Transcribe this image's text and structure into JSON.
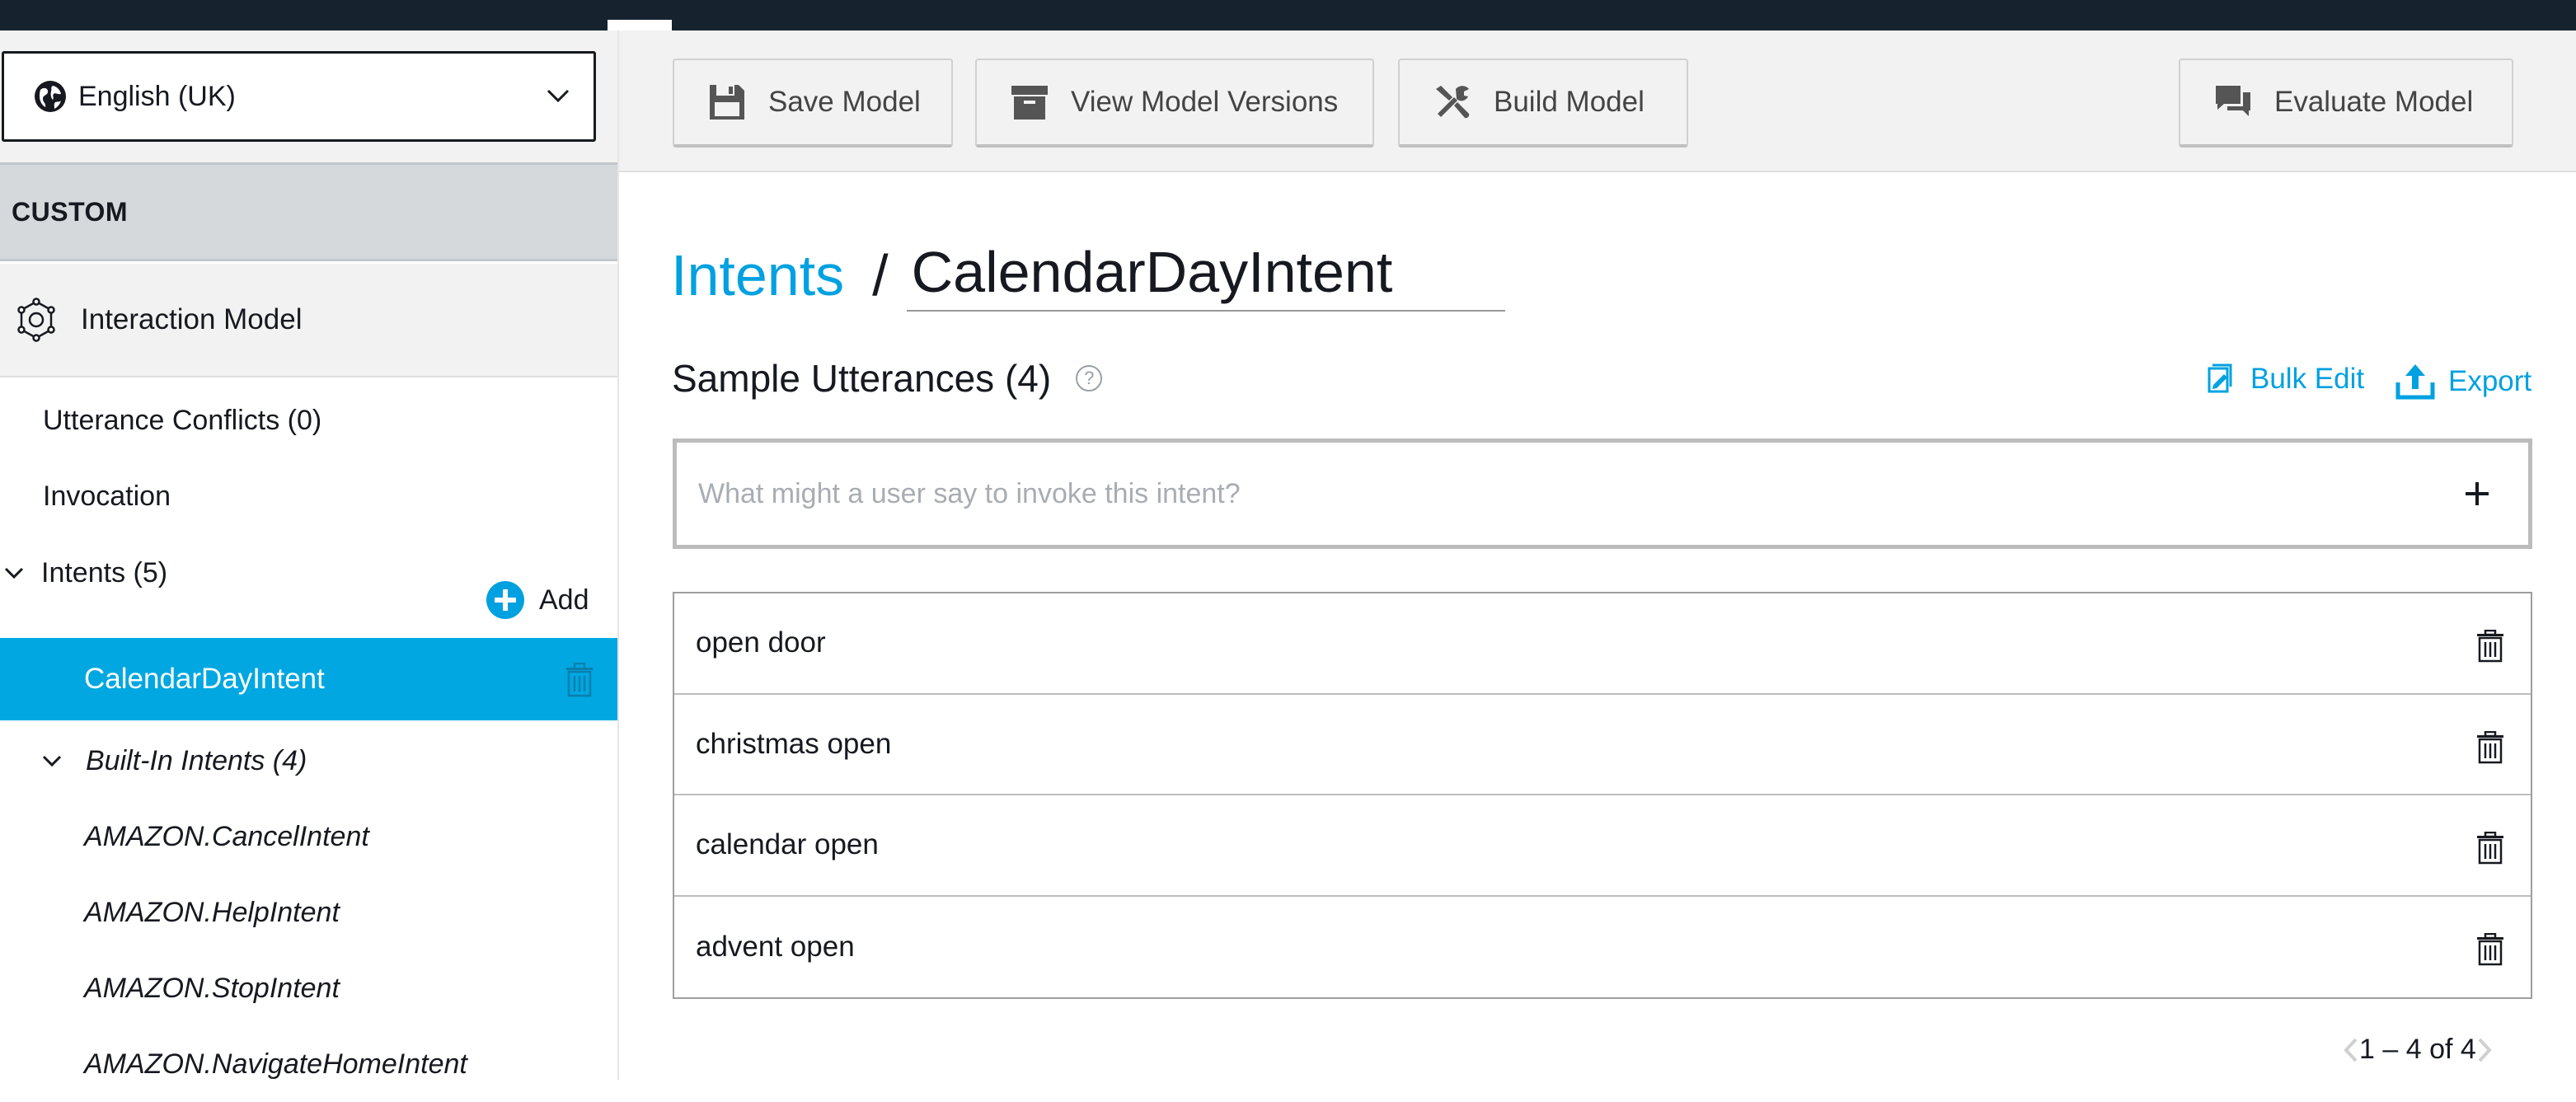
{
  "locale": {
    "selected": "English (UK)"
  },
  "sidebar": {
    "section_label": "CUSTOM",
    "interaction_model": "Interaction Model",
    "utterance_conflicts": "Utterance Conflicts (0)",
    "invocation": "Invocation",
    "intents_label": "Intents (5)",
    "add_label": "Add",
    "selected_intent": "CalendarDayIntent",
    "builtin_label": "Built-In Intents (4)",
    "builtin_items": [
      "AMAZON.CancelIntent",
      "AMAZON.HelpIntent",
      "AMAZON.StopIntent",
      "AMAZON.NavigateHomeIntent"
    ]
  },
  "toolbar": {
    "save_label": "Save Model",
    "versions_label": "View Model Versions",
    "build_label": "Build Model",
    "evaluate_label": "Evaluate Model"
  },
  "main": {
    "breadcrumb_link": "Intents",
    "breadcrumb_sep": "/",
    "intent_name": "CalendarDayIntent",
    "sample_title": "Sample Utterances (4)",
    "help_symbol": "?",
    "bulk_edit_label": "Bulk Edit",
    "export_label": "Export",
    "utterance_placeholder": "What might a user say to invoke this intent?",
    "utterances": [
      "open door",
      "christmas open",
      "calendar open",
      "advent open"
    ],
    "pagination": "1 – 4 of 4"
  },
  "colors": {
    "accent": "#00a1e0",
    "topbar": "#16232f",
    "selected_bg": "#00a7e1"
  }
}
